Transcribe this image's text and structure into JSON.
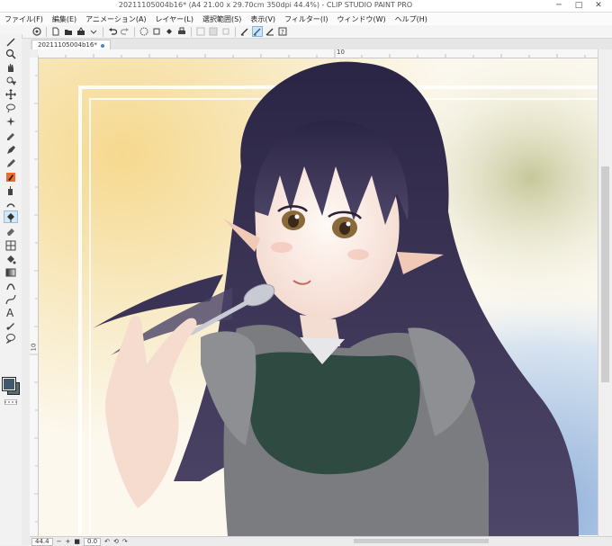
{
  "window": {
    "title": "20211105004b16* (A4 21.00 x 29.70cm 350dpi 44.4%) - CLIP STUDIO PAINT PRO",
    "controls": [
      "─",
      "□",
      "✕"
    ]
  },
  "menu": [
    "ファイル(F)",
    "編集(E)",
    "アニメーション(A)",
    "レイヤー(L)",
    "選択範囲(S)",
    "表示(V)",
    "フィルター(I)",
    "ウィンドウ(W)",
    "ヘルプ(H)"
  ],
  "document_tab": {
    "label": "20211105004b16*"
  },
  "rulers": {
    "top_mark": "10",
    "left_mark": "10"
  },
  "status": {
    "zoom": "44.4",
    "angle": "0.0"
  },
  "colors": {
    "main": "#3f5a6b",
    "sub": "#5d6b75",
    "accent": "#f06a2c",
    "selected_tool": "#d5e6f6"
  }
}
